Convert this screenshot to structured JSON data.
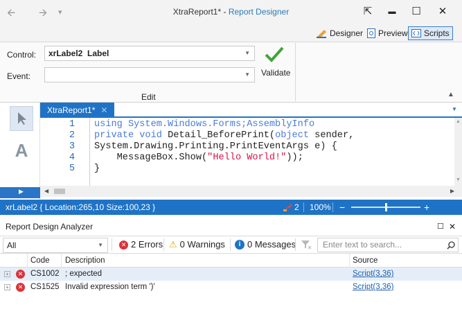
{
  "window": {
    "title_file": "XtraReport1*",
    "title_sep": " - ",
    "title_app": "Report Designer"
  },
  "qat": {
    "back": "🡨",
    "forward": "🡪",
    "menu": "▾"
  },
  "window_buttons": {
    "pin": "⇱",
    "minimize": "▬",
    "maximize": "☐",
    "close": "✕"
  },
  "ribbon_tabs": [
    {
      "label": "Designer",
      "selected": false
    },
    {
      "label": "Preview",
      "selected": false
    },
    {
      "label": "Scripts",
      "selected": true
    }
  ],
  "ribbon": {
    "control_label": "Control:",
    "control_value_name": "xrLabel2",
    "control_value_type": "Label",
    "event_label": "Event:",
    "event_value": "",
    "validate_label": "Validate",
    "group_label": "Edit"
  },
  "toolbox": {
    "pointer_icon": "pointer-icon",
    "label_icon": "A"
  },
  "document_tab": {
    "label": "XtraReport1*",
    "close": "✕"
  },
  "code": {
    "lines": [
      {
        "num": "1",
        "parts": [
          {
            "t": "using System.Windows.Forms;AssemblyInfo",
            "c": "kw"
          }
        ]
      },
      {
        "num": "2",
        "parts": [
          {
            "t": "private void ",
            "c": "kw"
          },
          {
            "t": "Detail_BeforePrint(",
            "c": ""
          },
          {
            "t": "object",
            "c": "kw"
          },
          {
            "t": " sender,",
            "c": ""
          }
        ]
      },
      {
        "num": "3",
        "parts": [
          {
            "t": "System.Drawing.Printing.PrintEventArgs e) {",
            "c": ""
          }
        ]
      },
      {
        "num": "4",
        "parts": [
          {
            "t": "    MessageBox.Show(",
            "c": ""
          },
          {
            "t": "\"Hello World!\"",
            "c": "str"
          },
          {
            "t": "));",
            "c": ""
          }
        ]
      },
      {
        "num": "5",
        "parts": [
          {
            "t": "}",
            "c": ""
          }
        ]
      }
    ]
  },
  "status": {
    "selection": "xrLabel2 { Location:265,10 Size:100,23 }",
    "error_count": "2",
    "zoom": "100%",
    "zoom_fraction": 0.5
  },
  "analyzer": {
    "title": "Report Design Analyzer",
    "filter_value": "All",
    "errors_label": "2 Errors",
    "warnings_label": "0 Warnings",
    "messages_label": "0 Messages",
    "search_placeholder": "Enter text to search...",
    "columns": {
      "code": "Code",
      "description": "Description",
      "source": "Source"
    },
    "rows": [
      {
        "code": "CS1002",
        "description": "; expected",
        "source": "Script(3,36)",
        "selected": true
      },
      {
        "code": "CS1525",
        "description": "Invalid expression term ')'",
        "source": "Script(3,36)",
        "selected": false
      }
    ]
  },
  "colors": {
    "accent": "#1f73c6",
    "error": "#d9343b",
    "warning": "#e8a700"
  }
}
